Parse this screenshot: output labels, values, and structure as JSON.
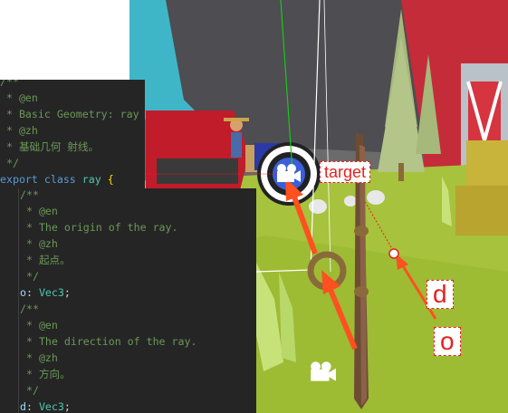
{
  "labels": {
    "target": "target",
    "d": "d",
    "o": "o"
  },
  "code": {
    "header_lines": [
      "/**",
      " * @en",
      " * Basic Geometry: ray",
      " * @zh",
      " * 基础几何 射线。",
      " */"
    ],
    "decl": {
      "keyword1": "export",
      "keyword2": "class",
      "name": "ray",
      "brace": "{"
    },
    "origin_doc": [
      "/**",
      " * @en",
      " * The origin of the ray.",
      " * @zh",
      " * 起点。",
      " */"
    ],
    "origin_prop": {
      "name": "o",
      "colon": ": ",
      "type": "Vec3",
      "semi": ";"
    },
    "direction_doc": [
      "/**",
      " * @en",
      " * The direction of the ray.",
      " * @zh",
      " * 方向。",
      " */"
    ],
    "direction_prop": {
      "name": "d",
      "colon": ": ",
      "type": "Vec3",
      "semi": ";"
    }
  },
  "colors": {
    "annotation": "#e8201e",
    "code_bg": "#252526",
    "comment": "#6a9955",
    "keyword": "#569cd6",
    "type": "#4ec9b0"
  },
  "icons": [
    "camera-icon",
    "camera-icon"
  ]
}
